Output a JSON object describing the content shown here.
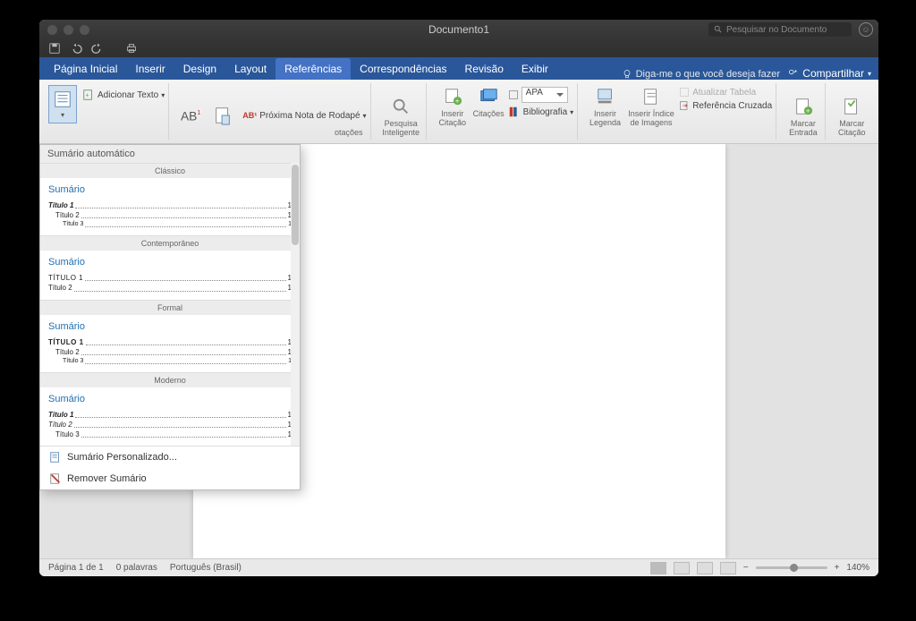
{
  "title": "Documento1",
  "search_placeholder": "Pesquisar no Documento",
  "tabs": {
    "home": "Página Inicial",
    "insert": "Inserir",
    "design": "Design",
    "layout": "Layout",
    "references": "Referências",
    "mailings": "Correspondências",
    "review": "Revisão",
    "view": "Exibir"
  },
  "tell_me": "Diga-me o que você deseja fazer",
  "share": "Compartilhar",
  "ribbon": {
    "add_text": "Adicionar Texto",
    "next_footnote": "Próxima Nota de Rodapé",
    "notations_suffix": "otações",
    "smart_lookup": "Pesquisa Inteligente",
    "insert_citation": "Inserir Citação",
    "citations": "Citações",
    "bibliography": "Bibliografia",
    "style_value": "APA",
    "insert_caption": "Inserir Legenda",
    "insert_index_images": "Inserir Índice de Imagens",
    "update_table": "Atualizar Tabela",
    "cross_reference": "Referência Cruzada",
    "mark_entry": "Marcar Entrada",
    "mark_citation": "Marcar Citação"
  },
  "gallery": {
    "header": "Sumário automático",
    "styles": [
      {
        "name": "Clássico",
        "title": "Sumário",
        "lines": [
          {
            "t": "Título 1",
            "cls": "bold it",
            "p": "1"
          },
          {
            "t": "Título 2",
            "cls": "ind1",
            "p": "1"
          },
          {
            "t": "Título 3",
            "cls": "ind2",
            "p": "1"
          }
        ]
      },
      {
        "name": "Contemporâneo",
        "title": "Sumário",
        "lines": [
          {
            "t": "TÍTULO 1",
            "cls": "caps",
            "p": "1"
          },
          {
            "t": "Título 2",
            "cls": "",
            "p": "1"
          }
        ]
      },
      {
        "name": "Formal",
        "title": "Sumário",
        "lines": [
          {
            "t": "TÍTULO 1",
            "cls": "caps bold",
            "p": "1"
          },
          {
            "t": "Título 2",
            "cls": "ind1",
            "p": "1"
          },
          {
            "t": "Título 3",
            "cls": "ind2",
            "p": "1"
          }
        ]
      },
      {
        "name": "Moderno",
        "title": "Sumário",
        "lines": [
          {
            "t": "Título 1",
            "cls": "bold it",
            "p": "1"
          },
          {
            "t": "Título 2",
            "cls": "it",
            "p": "1"
          },
          {
            "t": "Título 3",
            "cls": "ind1",
            "p": "1"
          }
        ]
      }
    ],
    "custom": "Sumário Personalizado...",
    "remove": "Remover Sumário"
  },
  "status": {
    "page": "Página 1 de 1",
    "words": "0 palavras",
    "lang": "Português (Brasil)",
    "zoom": "140%"
  }
}
